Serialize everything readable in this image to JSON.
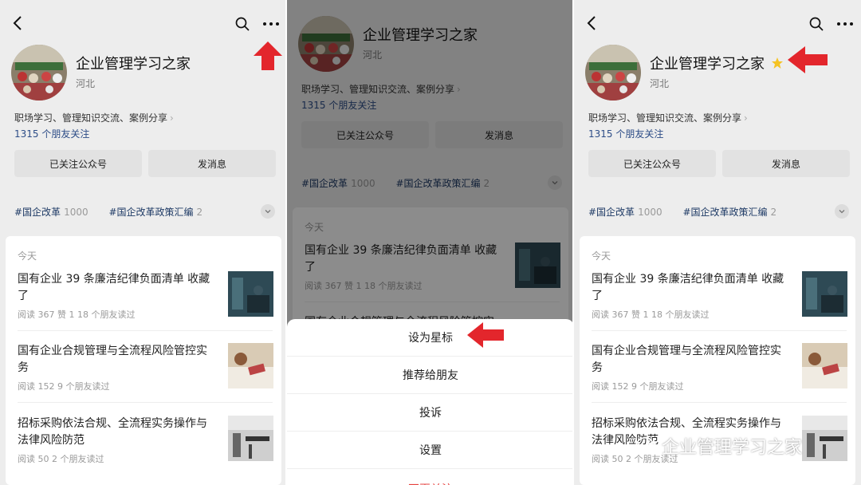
{
  "profile": {
    "name": "企业管理学习之家",
    "region": "河北",
    "description": "职场学习、管理知识交流、案例分享",
    "friends_following": "1315 个朋友关注",
    "followed_button": "已关注公众号",
    "message_button": "发消息"
  },
  "tags": [
    {
      "label": "#国企改革",
      "count": "1000"
    },
    {
      "label": "#国企改革政策汇编",
      "count": "2"
    }
  ],
  "feed": {
    "section_label": "今天",
    "articles": [
      {
        "title": "国有企业 39 条廉洁纪律负面清单 收藏了",
        "meta": "阅读 367  赞 1  18 个朋友读过"
      },
      {
        "title": "国有企业合规管理与全流程风险管控实务",
        "meta": "阅读 152  9 个朋友读过"
      },
      {
        "title": "招标采购依法合规、全流程实务操作与法律风险防范",
        "meta": "阅读 50  2 个朋友读过"
      }
    ]
  },
  "action_sheet": {
    "items": [
      "设为星标",
      "推荐给朋友",
      "投诉",
      "设置"
    ],
    "danger_item": "不再关注"
  },
  "watermark": {
    "text": "企业管理学习之家"
  },
  "colors": {
    "arrow": "#e3262c",
    "star": "#f5c324",
    "link": "#2d4d87"
  },
  "icons": {
    "back": "chevron-left-icon",
    "search": "search-icon",
    "more": "more-icon",
    "star": "star-icon"
  }
}
